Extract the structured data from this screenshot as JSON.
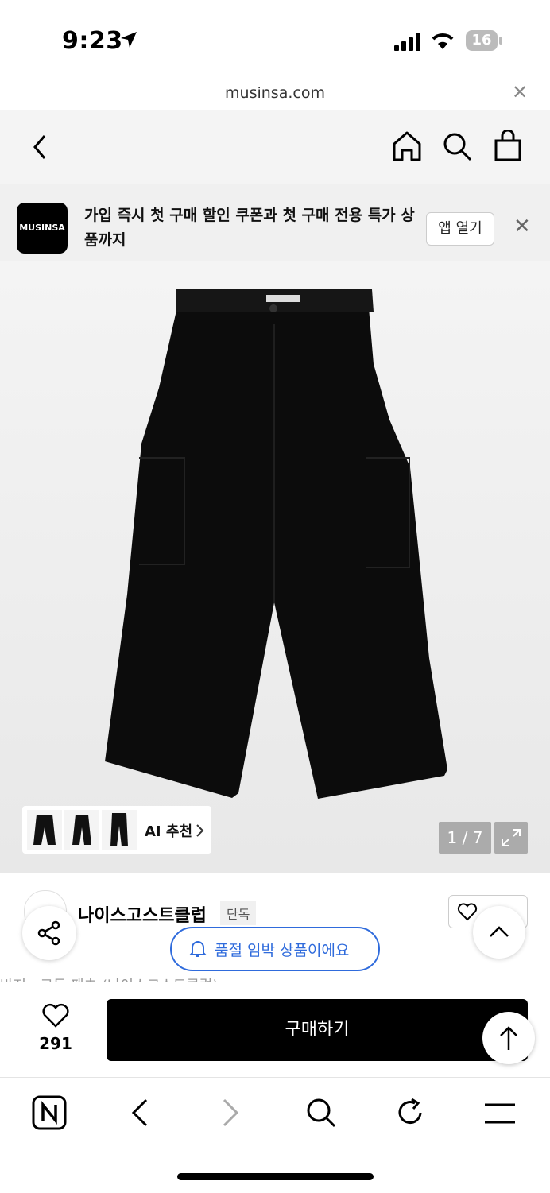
{
  "status_bar": {
    "time": "9:23",
    "battery": "16"
  },
  "url_bar": {
    "domain": "musinsa.com"
  },
  "banner": {
    "logo_text": "MUSINSA",
    "message": "가입 즉시 첫 구매 할인 쿠폰과 첫 구매 전용 특가 상품까지",
    "open_app_label": "앱 열기"
  },
  "product_image": {
    "thumbnails": [
      "pants-thumb-1",
      "pants-thumb-2",
      "pants-thumb-3"
    ],
    "ai_label": "AI 추천",
    "counter": "1 / 7"
  },
  "product": {
    "brand": "나이스고스트클럽",
    "brand_tag": "단독",
    "partial_title": "바지 · 코듀 팬츠 (나이스고스트클럽)"
  },
  "toast": {
    "text": "품절 임박 상품이에요"
  },
  "buy_bar": {
    "like_count": "291",
    "buy_label": "구매하기"
  },
  "colors": {
    "accent": "#2f6bdc",
    "buy_bg": "#000000"
  }
}
